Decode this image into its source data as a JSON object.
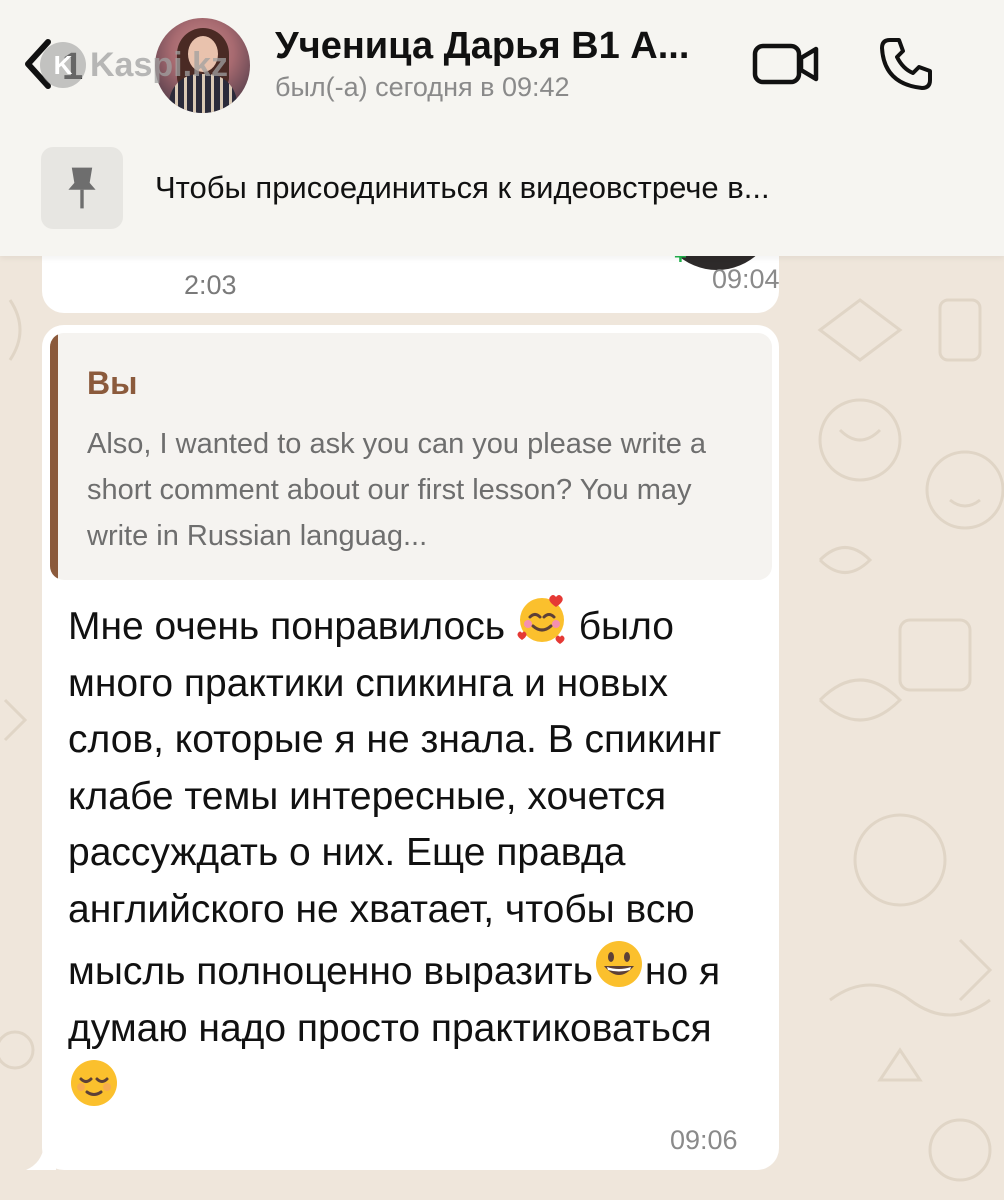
{
  "header": {
    "back_count": "1",
    "watermark": "Kaspi.kz",
    "contact_name": "Ученица Дарья В1 А...",
    "status": "был(-а) сегодня в 09:42"
  },
  "pinned": {
    "text": "Чтобы присоединиться к видеовстрече в..."
  },
  "previous_message": {
    "duration": "2:03",
    "time": "09:04"
  },
  "message": {
    "quote_author": "Вы",
    "quote_text": "Also, I wanted to ask you can you please write a short comment about our first lesson? You may write in Russian languag...",
    "text_part1": "Мне очень понравилось ",
    "emoji1": "smiling-face-with-hearts",
    "text_part2": " было много практики спикинга и новых слов, которые я не знала. В спикинг клабе темы интересные, хочется рассуждать о них. Еще правда английского не хватает, чтобы всю мысль полноценно выразить",
    "emoji2": "grinning-face",
    "text_part3": "но я думаю надо просто практиковаться ",
    "emoji3": "relieved-face",
    "time": "09:06"
  },
  "colors": {
    "quote_accent": "#8b5a3c",
    "header_bg": "#f6f5f1",
    "wallpaper": "#efe6db"
  }
}
